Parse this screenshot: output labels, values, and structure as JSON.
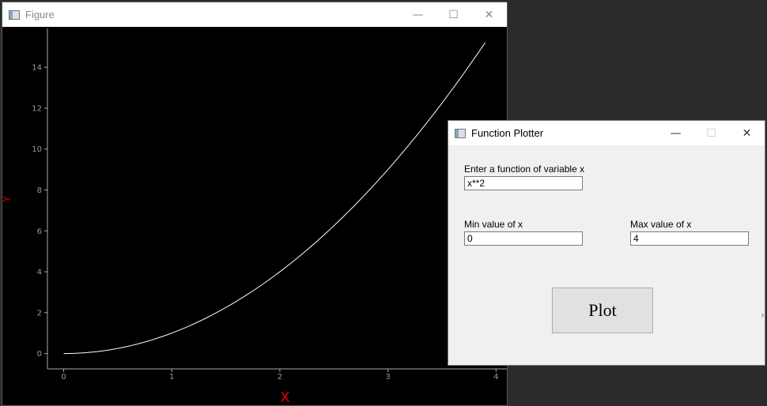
{
  "figure_window": {
    "title": "Figure",
    "controls": {
      "minimize": "—",
      "maximize": "☐",
      "close": "✕"
    }
  },
  "chart_data": {
    "type": "line",
    "function": "x**2",
    "xlabel": "X",
    "ylabel": "Y",
    "xlim": [
      -0.15,
      4.1
    ],
    "ylim": [
      -0.75,
      15.9
    ],
    "x_ticks": [
      0,
      1,
      2,
      3,
      4
    ],
    "y_ticks": [
      0,
      2,
      4,
      6,
      8,
      10,
      12,
      14
    ],
    "x_range": [
      0,
      3.9
    ],
    "samples": 80,
    "grid": false,
    "colors": {
      "background": "#000000",
      "line": "#ffffff",
      "axis": "#aaaaaa",
      "tick_label": "#999999",
      "axis_label": "#e00000"
    }
  },
  "plotter_window": {
    "title": "Function Plotter",
    "controls": {
      "minimize": "—",
      "maximize": "☐",
      "close": "✕"
    },
    "function_label": "Enter a function of variable x",
    "function_value": "x**2",
    "min_label": "Min value of x",
    "min_value": "0",
    "max_label": "Max value of  x",
    "max_value": "4",
    "plot_button": "Plot"
  }
}
